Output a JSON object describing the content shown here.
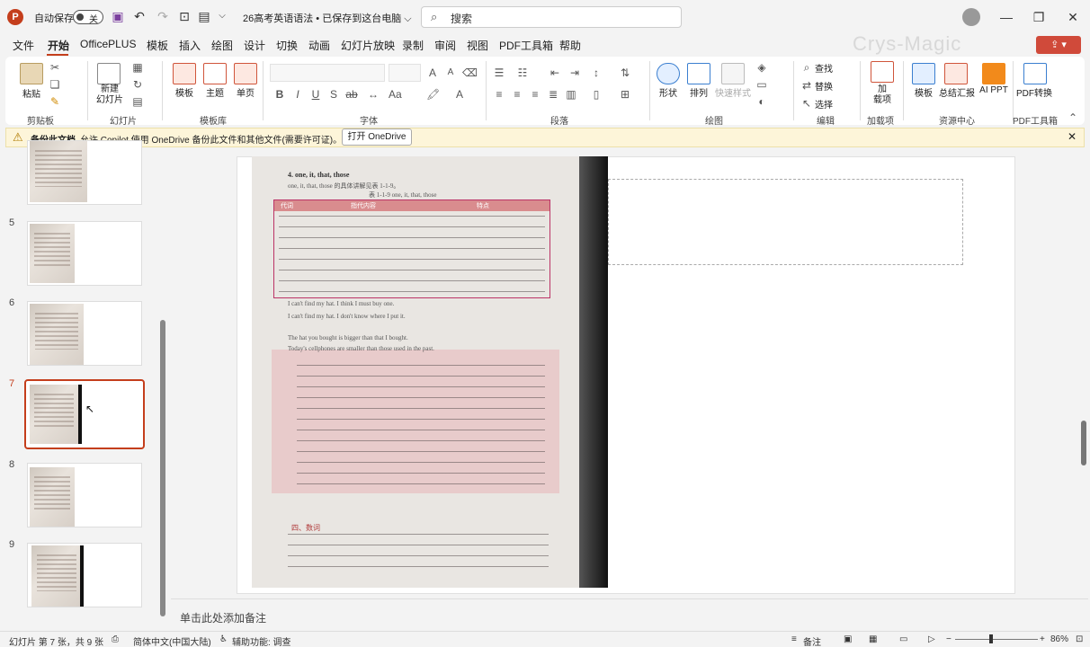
{
  "titlebar": {
    "logo": "P",
    "autosave_label": "自动保存",
    "autosave_state": "关",
    "doc_title": "26高考英语语法 • 已保存到这台电脑 ⌵",
    "search_placeholder": "搜索"
  },
  "menu": [
    "文件",
    "开始",
    "OfficePLUS",
    "模板",
    "插入",
    "绘图",
    "设计",
    "切换",
    "动画",
    "幻灯片放映",
    "录制",
    "审阅",
    "视图",
    "PDF工具箱",
    "帮助"
  ],
  "menu_active": "开始",
  "watermark": "Crys-Magic",
  "ribbon": {
    "paste": "粘贴",
    "new_slide": "新建\n幻灯片",
    "template_btn": "模板",
    "theme_btn": "主题",
    "single_page": "单页",
    "shape": "形状",
    "arrange": "排列",
    "quick_style": "快速样式",
    "find": "查找",
    "replace": "替换",
    "select": "选择",
    "addins": "加\n载项",
    "res_template": "模板",
    "summary": "总结汇报",
    "ai_ppt": "AI PPT",
    "pdf_convert": "PDF转换",
    "groups": {
      "clipboard": "剪贴板",
      "slides": "幻灯片",
      "template_lib": "模板库",
      "font": "字体",
      "paragraph": "段落",
      "drawing": "绘图",
      "editing": "编辑",
      "addins": "加载项",
      "resources": "资源中心",
      "pdf": "PDF工具箱"
    }
  },
  "infobar": {
    "title": "备份此文档",
    "message": "允许 Copilot 使用 OneDrive 备份此文件和其他文件(需要许可证)。",
    "button": "打开 OneDrive"
  },
  "slides_panel": [
    {
      "number": "",
      "selected": false
    },
    {
      "number": "5",
      "selected": false
    },
    {
      "number": "6",
      "selected": false
    },
    {
      "number": "7",
      "selected": true
    },
    {
      "number": "8",
      "selected": false
    },
    {
      "number": "9",
      "selected": false
    }
  ],
  "page_content": {
    "heading": "4. one, it, that, those",
    "intro": "one, it, that, those 的具体讲解见表 1-1-9。",
    "table_caption": "表 1-1-9   one, it, that, those",
    "col1": "代词",
    "col2": "指代内容",
    "col3": "特点",
    "example1": "I can't find my hat. I think I must buy one.",
    "example2": "I can't find my hat. I don't know where I put it.",
    "example3": "The hat you bought is bigger than that I bought.",
    "example4": "Today's cellphones are smaller than those used in the past.",
    "section": "四、数词"
  },
  "notes_placeholder": "单击此处添加备注",
  "status": {
    "slide_info": "幻灯片 第 7 张，共 9 张",
    "language": "简体中文(中国大陆)",
    "accessibility": "辅助功能: 调查",
    "notes": "备注",
    "zoom": "86%"
  },
  "colors": {
    "accent": "#c43e1c",
    "infobar_bg": "#fdf5d9"
  }
}
